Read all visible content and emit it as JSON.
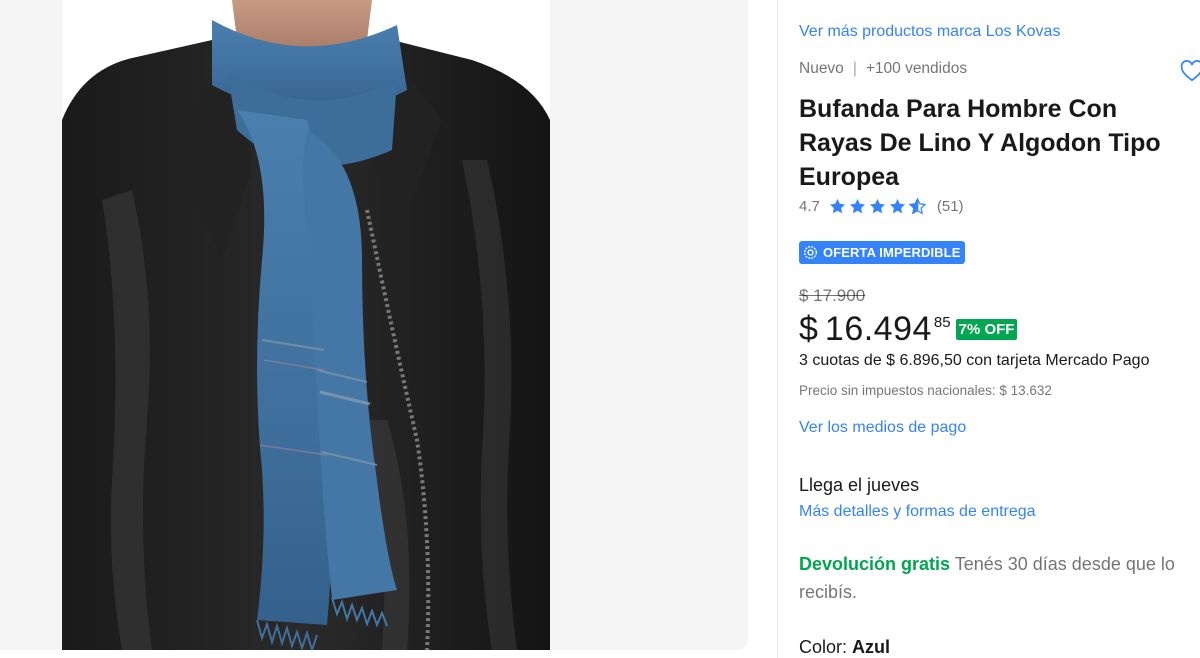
{
  "product": {
    "brand_link": "Ver más productos marca Los Kovas",
    "condition": "Nuevo",
    "separator": "|",
    "sold": "+100 vendidos",
    "title": "Bufanda Para Hombre Con Rayas De Lino Y Algodon Tipo Europea",
    "image_alt": "Bufanda azul de lino"
  },
  "rating": {
    "average": "4.7",
    "stars": 4.7,
    "count": "(51)"
  },
  "badge": {
    "label": "OFERTA IMPERDIBLE",
    "icon": "gear-badge-icon"
  },
  "price": {
    "original": "$ 17.900",
    "currency": "$",
    "amount": "16.494",
    "cents": "85",
    "discount": "7% OFF",
    "installments": "3 cuotas de $ 6.896,50 con tarjeta Mercado Pago",
    "tax_note": "Precio sin impuestos nacionales: $ 13.632",
    "payment_link": "Ver los medios de pago"
  },
  "shipping": {
    "arrival": "Llega el jueves",
    "details_link": "Más detalles y formas de entrega"
  },
  "returns": {
    "highlight": "Devolución gratis",
    "text": "Tenés 30 días desde que lo recibís."
  },
  "variant": {
    "label": "Color:",
    "value": "Azul"
  },
  "colors": {
    "link": "#3483fa",
    "badge": "#3483fa",
    "discount": "#00a650",
    "star": "#3483fa"
  },
  "icons": {
    "favorite": "heart-icon",
    "star": "star-icon"
  }
}
